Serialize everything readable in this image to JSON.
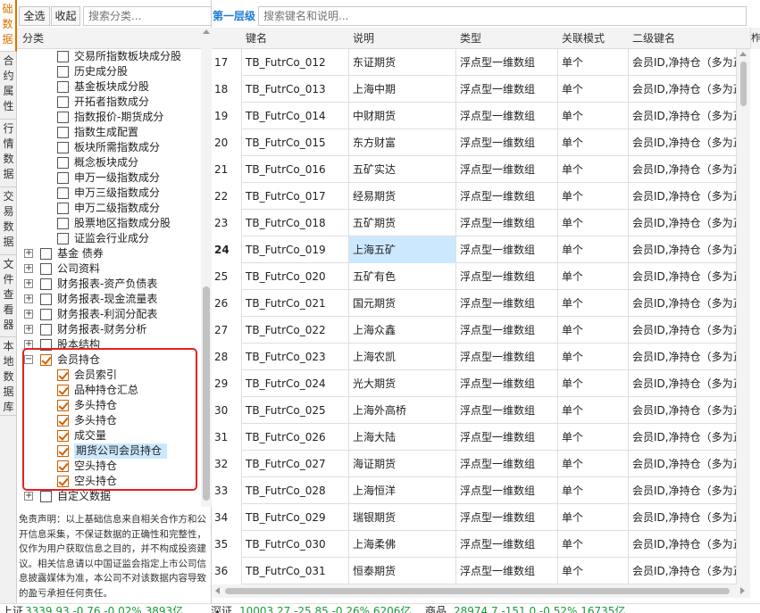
{
  "side_tabs": [
    {
      "label": "础数据",
      "active": true
    },
    {
      "label": "合约属性",
      "active": false
    },
    {
      "label": "行情数据",
      "active": false
    },
    {
      "label": "交易数据",
      "active": false
    },
    {
      "label": "文件查看器",
      "active": false
    },
    {
      "label": "本地数据库",
      "active": false
    }
  ],
  "left_toolbar": {
    "select_all": "全选",
    "collapse": "收起",
    "search_placeholder": "搜索分类..."
  },
  "category_header": "分类",
  "tree": [
    {
      "label": "交易所指数板块成分股",
      "level": 2,
      "checked": false
    },
    {
      "label": "历史成分股",
      "level": 2,
      "checked": false
    },
    {
      "label": "基金板块成分股",
      "level": 2,
      "checked": false
    },
    {
      "label": "开拓者指数成分",
      "level": 2,
      "checked": false
    },
    {
      "label": "指数报价-期货成分",
      "level": 2,
      "checked": false
    },
    {
      "label": "指数生成配置",
      "level": 2,
      "checked": false
    },
    {
      "label": "板块所需指数成分",
      "level": 2,
      "checked": false
    },
    {
      "label": "概念板块成分",
      "level": 2,
      "checked": false
    },
    {
      "label": "申万一级指数成分",
      "level": 2,
      "checked": false
    },
    {
      "label": "申万三级指数成分",
      "level": 2,
      "checked": false
    },
    {
      "label": "申万二级指数成分",
      "level": 2,
      "checked": false
    },
    {
      "label": "股票地区指数成分股",
      "level": 2,
      "checked": false
    },
    {
      "label": "证监会行业成分",
      "level": 2,
      "checked": false
    },
    {
      "label": "基金 债券",
      "level": 1,
      "checked": false,
      "expander": "+"
    },
    {
      "label": "公司资料",
      "level": 1,
      "checked": false,
      "expander": "+"
    },
    {
      "label": "财务报表-资产负债表",
      "level": 1,
      "checked": false,
      "expander": "+"
    },
    {
      "label": "财务报表-现金流量表",
      "level": 1,
      "checked": false,
      "expander": "+"
    },
    {
      "label": "财务报表-利润分配表",
      "level": 1,
      "checked": false,
      "expander": "+"
    },
    {
      "label": "财务报表-财务分析",
      "level": 1,
      "checked": false,
      "expander": "+"
    },
    {
      "label": "股本结构",
      "level": 1,
      "checked": false,
      "expander": "+"
    },
    {
      "label": "会员持仓",
      "level": 1,
      "checked": true,
      "expander": "−"
    },
    {
      "label": "会员索引",
      "level": 2,
      "checked": true
    },
    {
      "label": "品种持仓汇总",
      "level": 2,
      "checked": true
    },
    {
      "label": "多头持仓",
      "level": 2,
      "checked": true
    },
    {
      "label": "多头持仓",
      "level": 2,
      "checked": true
    },
    {
      "label": "成交量",
      "level": 2,
      "checked": true
    },
    {
      "label": "期货公司会员持仓",
      "level": 2,
      "checked": true,
      "selected": true
    },
    {
      "label": "空头持仓",
      "level": 2,
      "checked": true
    },
    {
      "label": "空头持仓",
      "level": 2,
      "checked": true
    },
    {
      "label": "自定义数据",
      "level": 1,
      "checked": false,
      "expander": "+"
    }
  ],
  "disclaimer": "免责声明：以上基础信息来自相关合作方和公开信息采集，不保证数据的正确性和完整性，仅作为用户获取信息之目的，并不构成投资建议。相关信息请以中国证监会指定上市公司信息披露媒体为准，本公司不对该数据内容导致的盈亏承担任何责任。",
  "right_toolbar": {
    "level_label": "第一层级",
    "search_placeholder": "搜索键名和说明...",
    "edge_tab": "柞"
  },
  "grid": {
    "columns": [
      "",
      "键名",
      "说明",
      "类型",
      "关联模式",
      "二级键名"
    ],
    "rows": [
      {
        "idx": "17",
        "key": "TB_FutrCo_012",
        "desc": "东证期货",
        "type": "浮点型一维数组",
        "mode": "单个",
        "sub": "会员ID,净持仓（多为正"
      },
      {
        "idx": "18",
        "key": "TB_FutrCo_013",
        "desc": "上海中期",
        "type": "浮点型一维数组",
        "mode": "单个",
        "sub": "会员ID,净持仓（多为正"
      },
      {
        "idx": "19",
        "key": "TB_FutrCo_014",
        "desc": "中财期货",
        "type": "浮点型一维数组",
        "mode": "单个",
        "sub": "会员ID,净持仓（多为正"
      },
      {
        "idx": "20",
        "key": "TB_FutrCo_015",
        "desc": "东方财富",
        "type": "浮点型一维数组",
        "mode": "单个",
        "sub": "会员ID,净持仓（多为正"
      },
      {
        "idx": "21",
        "key": "TB_FutrCo_016",
        "desc": "五矿实达",
        "type": "浮点型一维数组",
        "mode": "单个",
        "sub": "会员ID,净持仓（多为正"
      },
      {
        "idx": "22",
        "key": "TB_FutrCo_017",
        "desc": "经易期货",
        "type": "浮点型一维数组",
        "mode": "单个",
        "sub": "会员ID,净持仓（多为正"
      },
      {
        "idx": "23",
        "key": "TB_FutrCo_018",
        "desc": "五矿期货",
        "type": "浮点型一维数组",
        "mode": "单个",
        "sub": "会员ID,净持仓（多为正"
      },
      {
        "idx": "24",
        "key": "TB_FutrCo_019",
        "desc": "上海五矿",
        "type": "浮点型一维数组",
        "mode": "单个",
        "sub": "会员ID,净持仓（多为正",
        "current": true
      },
      {
        "idx": "25",
        "key": "TB_FutrCo_020",
        "desc": "五矿有色",
        "type": "浮点型一维数组",
        "mode": "单个",
        "sub": "会员ID,净持仓（多为正"
      },
      {
        "idx": "26",
        "key": "TB_FutrCo_021",
        "desc": "国元期货",
        "type": "浮点型一维数组",
        "mode": "单个",
        "sub": "会员ID,净持仓（多为正"
      },
      {
        "idx": "27",
        "key": "TB_FutrCo_022",
        "desc": "上海众鑫",
        "type": "浮点型一维数组",
        "mode": "单个",
        "sub": "会员ID,净持仓（多为正"
      },
      {
        "idx": "28",
        "key": "TB_FutrCo_023",
        "desc": "上海农凯",
        "type": "浮点型一维数组",
        "mode": "单个",
        "sub": "会员ID,净持仓（多为正"
      },
      {
        "idx": "29",
        "key": "TB_FutrCo_024",
        "desc": "光大期货",
        "type": "浮点型一维数组",
        "mode": "单个",
        "sub": "会员ID,净持仓（多为正"
      },
      {
        "idx": "30",
        "key": "TB_FutrCo_025",
        "desc": "上海外高桥",
        "type": "浮点型一维数组",
        "mode": "单个",
        "sub": "会员ID,净持仓（多为正"
      },
      {
        "idx": "31",
        "key": "TB_FutrCo_026",
        "desc": "上海大陆",
        "type": "浮点型一维数组",
        "mode": "单个",
        "sub": "会员ID,净持仓（多为正"
      },
      {
        "idx": "32",
        "key": "TB_FutrCo_027",
        "desc": "海证期货",
        "type": "浮点型一维数组",
        "mode": "单个",
        "sub": "会员ID,净持仓（多为正"
      },
      {
        "idx": "33",
        "key": "TB_FutrCo_028",
        "desc": "上海恒洋",
        "type": "浮点型一维数组",
        "mode": "单个",
        "sub": "会员ID,净持仓（多为正"
      },
      {
        "idx": "34",
        "key": "TB_FutrCo_029",
        "desc": "瑞银期货",
        "type": "浮点型一维数组",
        "mode": "单个",
        "sub": "会员ID,净持仓（多为正"
      },
      {
        "idx": "35",
        "key": "TB_FutrCo_030",
        "desc": "上海柔佛",
        "type": "浮点型一维数组",
        "mode": "单个",
        "sub": "会员ID,净持仓（多为正"
      },
      {
        "idx": "36",
        "key": "TB_FutrCo_031",
        "desc": "恒泰期货",
        "type": "浮点型一维数组",
        "mode": "单个",
        "sub": "会员ID,净持仓（多为正"
      }
    ]
  },
  "status_bar": {
    "sh_name": "上证",
    "sh_values": "3339.93  -0.76  -0.02%  3893亿",
    "sz_name": "深证",
    "sz_values": "10003.27  -25.85  -0.26%  6206亿",
    "cm_name": "商品",
    "cm_values": "28974.7  -151.0  -0.52%  16735亿"
  },
  "colors": {
    "accent": "#1e7cd6",
    "active_tab": "#e07000",
    "check": "#d25f00",
    "highlight_box": "#e62020",
    "selection": "#cce8ff",
    "down": "#1a9a3a"
  }
}
